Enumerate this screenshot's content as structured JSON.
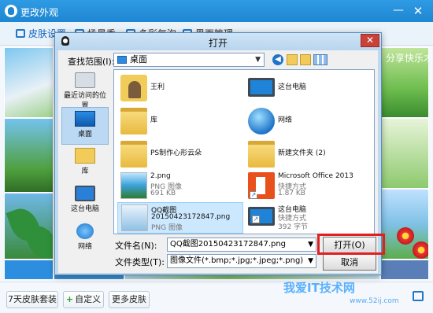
{
  "background_window": {
    "title": "更改外观",
    "minimize_glyph": "—",
    "close_glyph": "✕",
    "tabs": [
      "皮肤设置",
      "场景秀",
      "多彩气泡",
      "界面管理"
    ],
    "thumbnail_text": "分享快乐才会快乐",
    "footer_buttons": {
      "seven_day": "7天皮肤套装",
      "custom": "自定义",
      "more": "更多皮肤"
    },
    "watermark": "我爱IT技术网",
    "watermark_url": "www.52ij.com"
  },
  "dialog": {
    "title": "打开",
    "close_glyph": "✕",
    "look_in_label": "查找范围(I):",
    "look_in_value": "桌面",
    "places": [
      {
        "label": "最近访问的位置",
        "icon": "recent-places-icon"
      },
      {
        "label": "桌面",
        "icon": "desktop-icon"
      },
      {
        "label": "库",
        "icon": "library-icon"
      },
      {
        "label": "这台电脑",
        "icon": "computer-icon"
      },
      {
        "label": "网络",
        "icon": "network-icon"
      }
    ],
    "files": [
      {
        "name": "王利",
        "type": "",
        "size": "",
        "icon": "user-folder-icon"
      },
      {
        "name": "这台电脑",
        "type": "",
        "size": "",
        "icon": "computer-icon"
      },
      {
        "name": "库",
        "type": "",
        "size": "",
        "icon": "library-folder-icon"
      },
      {
        "name": "网络",
        "type": "",
        "size": "",
        "icon": "network-icon"
      },
      {
        "name": "PS制作心形云朵",
        "type": "",
        "size": "",
        "icon": "folder-icon"
      },
      {
        "name": "新建文件夹 (2)",
        "type": "",
        "size": "",
        "icon": "folder-icon"
      },
      {
        "name": "2.png",
        "type": "PNG 图像",
        "size": "691 KB",
        "icon": "image-thumbnail-icon"
      },
      {
        "name": "Microsoft Office 2013",
        "type": "快捷方式",
        "size": "1.87 KB",
        "icon": "office-shortcut-icon"
      },
      {
        "name": "QQ截图",
        "name2": "20150423172847.png",
        "type": "PNG 图像",
        "size": "",
        "icon": "image-thumbnail-icon"
      },
      {
        "name": "这台电脑",
        "type": "快捷方式",
        "size": "392 字节",
        "icon": "computer-shortcut-icon"
      }
    ],
    "filename_label": "文件名(N):",
    "filename_value": "QQ截图20150423172847.png",
    "filetype_label": "文件类型(T):",
    "filetype_value": "图像文件(*.bmp;*.jpg;*.jpeg;*.png)",
    "open_button": "打开(O)",
    "cancel_button": "取消"
  },
  "colors": {
    "titlebar": "#1e86d2",
    "highlight": "#e02020",
    "selection": "#cce8ff"
  }
}
